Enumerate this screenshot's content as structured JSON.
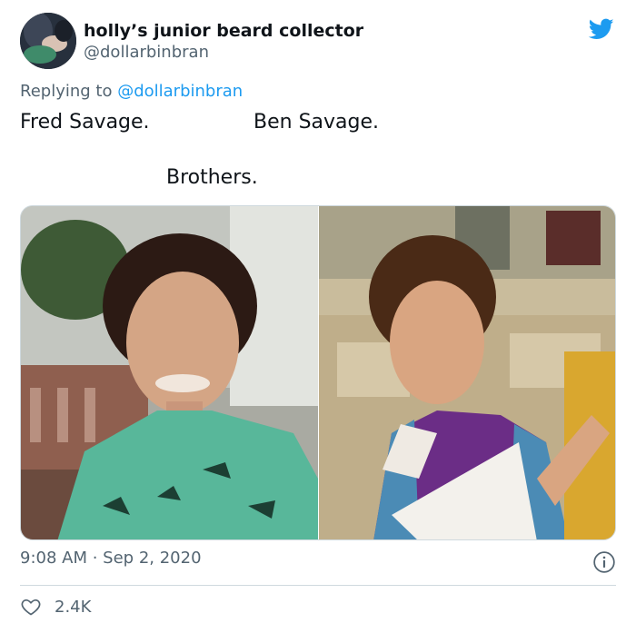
{
  "colors": {
    "text": "#0f1419",
    "muted": "#536471",
    "link": "#1d9bf0",
    "twitter_blue": "#1d9bf0",
    "border": "#cfd9de"
  },
  "author": {
    "display_name": "holly’s junior beard collector",
    "handle": "@dollarbinbran"
  },
  "reply": {
    "prefix": "Replying to ",
    "handle": "@dollarbinbran"
  },
  "tweet": {
    "left_name": "Fred Savage.",
    "right_name": "Ben Savage.",
    "caption": "Brothers."
  },
  "media": {
    "left_photo": "fred-savage-photo",
    "right_photo": "ben-savage-photo"
  },
  "meta": {
    "time": "9:08 AM",
    "separator": " · ",
    "date": "Sep 2, 2020"
  },
  "actions": {
    "like_count": "2.4K"
  },
  "icons": [
    "twitter-bird-icon",
    "info-icon",
    "heart-icon"
  ]
}
